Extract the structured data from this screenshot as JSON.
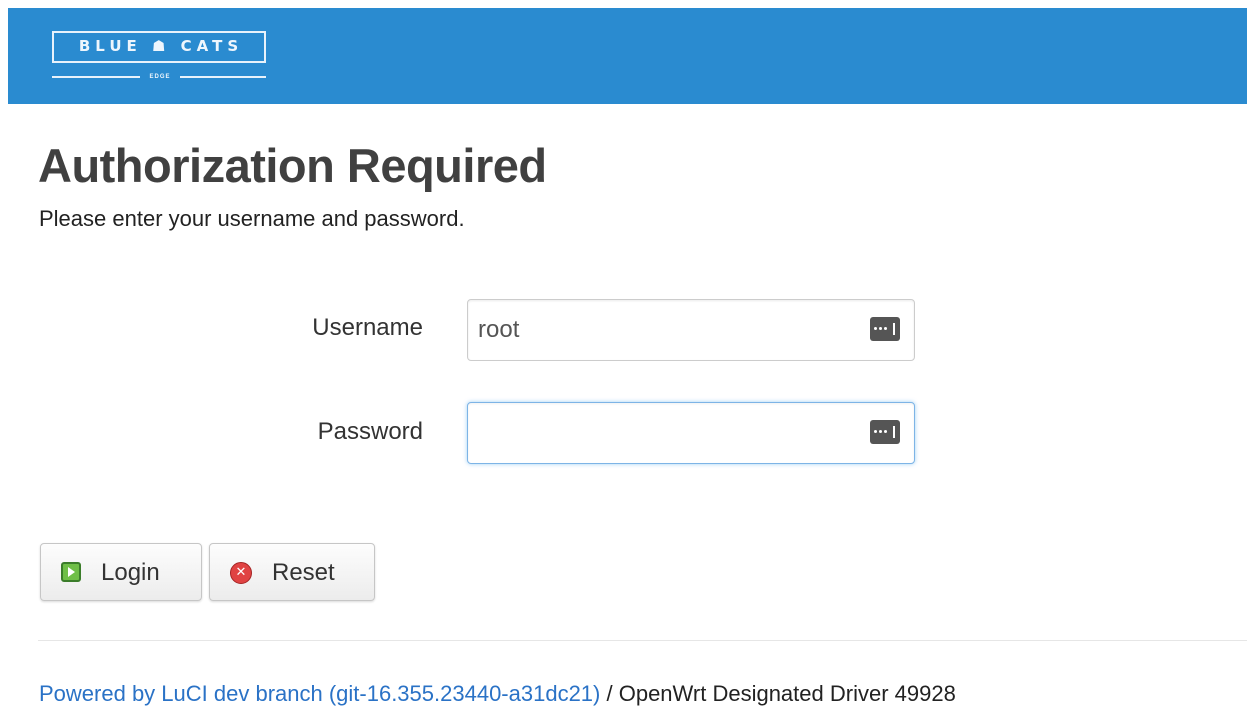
{
  "header": {
    "logo_text": "BLUE ☗ CATS",
    "logo_sub": "EDGE",
    "brand_color": "#2a8bd0"
  },
  "main": {
    "title": "Authorization Required",
    "subtitle": "Please enter your username and password."
  },
  "form": {
    "username_label": "Username",
    "username_value": "root",
    "password_label": "Password",
    "password_value": "",
    "field_icon": "password-manager-key-icon"
  },
  "buttons": {
    "login_label": "Login",
    "login_icon": "play-icon",
    "reset_label": "Reset",
    "reset_icon": "close-circle-icon",
    "reset_glyph": "✕"
  },
  "footer": {
    "link_text": "Powered by LuCI dev branch (git-16.355.23440-a31dc21)",
    "separator": " / ",
    "version_text": "OpenWrt Designated Driver 49928",
    "link_color": "#2a72c6"
  }
}
